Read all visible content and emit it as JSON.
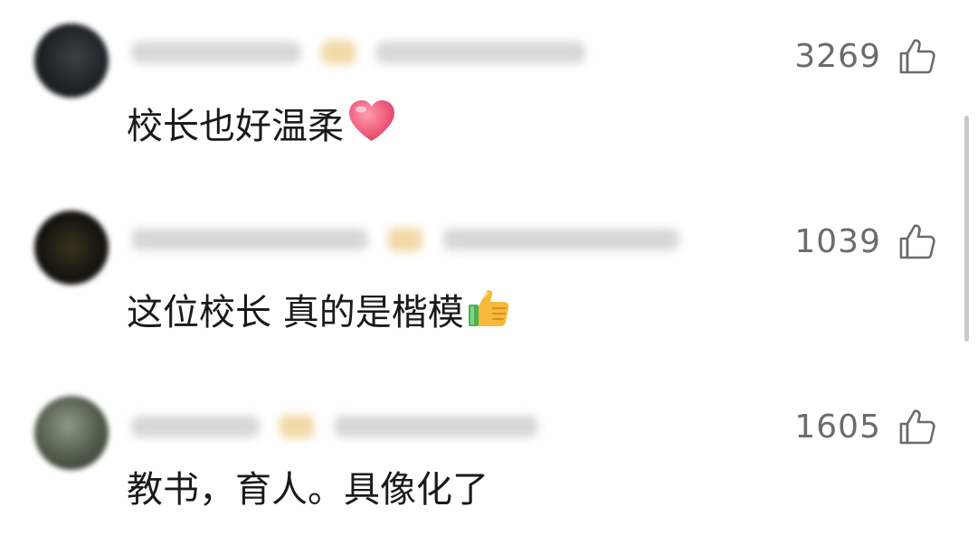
{
  "comments": [
    {
      "text": "校长也好温柔",
      "emoji": "heart-emoji",
      "likes": "3269",
      "avatar_color": "#1f2328"
    },
    {
      "text": "这位校长 真的是楷模",
      "emoji": "thumbs-up-emoji",
      "likes": "1039",
      "avatar_color": "#17150f"
    },
    {
      "text": "教书，育人。具像化了",
      "emoji": "",
      "likes": "1605",
      "avatar_color": "#4f5a4a"
    }
  ],
  "colors": {
    "text": "#1a1a1a",
    "likes": "#6b6b6b",
    "blur": "#d7d7d7",
    "vip": "#f1d9a7"
  }
}
